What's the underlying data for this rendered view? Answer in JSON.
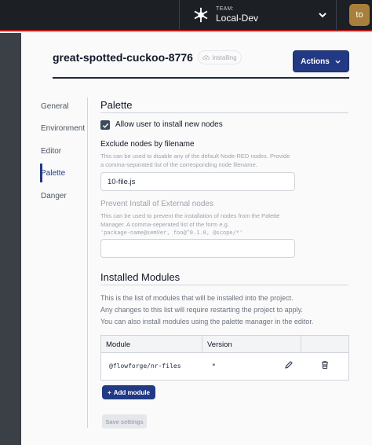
{
  "team": {
    "label": "TEAM:",
    "name": "Local-Dev"
  },
  "user": {
    "initials": "to"
  },
  "project": {
    "name": "great-spotted-cuckoo-8776",
    "status": "installing"
  },
  "actions": {
    "label": "Actions"
  },
  "nav": {
    "items": [
      {
        "label": "General",
        "active": false
      },
      {
        "label": "Environment",
        "active": false
      },
      {
        "label": "Editor",
        "active": false
      },
      {
        "label": "Palette",
        "active": true
      },
      {
        "label": "Danger",
        "active": false
      }
    ]
  },
  "palette": {
    "heading": "Palette",
    "allow_install": {
      "label": "Allow user to install new nodes",
      "checked": true
    },
    "exclude": {
      "label": "Exclude nodes by filename",
      "help1": "This can be used to disable any of the default Node-RED nodes. Provide",
      "help2": "a comma-separated list of the corresponding node filename.",
      "value": "10-file.js"
    },
    "prevent": {
      "label": "Prevent Install of External nodes",
      "help1": "This can be used to prevent the installation of nodes from the Palette",
      "help2": "Manager. A comma-seperated list of the form e.g.",
      "help3": "'package-name@semVer, foo@^0.1.0, @scope/*'",
      "value": ""
    }
  },
  "modules": {
    "heading": "Installed Modules",
    "desc1": "This is the list of modules that will be installed into the project.",
    "desc2": "Any changes to this list will require restarting the project to apply.",
    "desc3": "You can also install modules using the palette manager in the editor.",
    "columns": {
      "module": "Module",
      "version": "Version"
    },
    "rows": [
      {
        "module": "@flowforge/nr-files",
        "version": "*"
      }
    ],
    "add_label": "Add module"
  },
  "save": {
    "label": "Save settings"
  },
  "colors": {
    "primary": "#223a84",
    "topbar": "#1c1f24",
    "accent_red": "#b91c1c",
    "avatar": "#a8803b"
  }
}
